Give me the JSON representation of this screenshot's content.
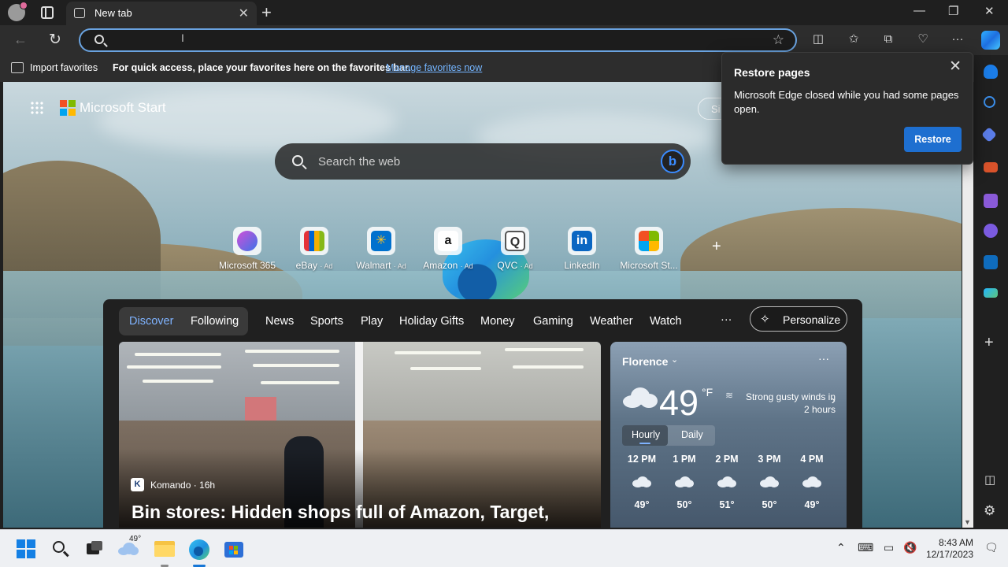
{
  "browser": {
    "tab_title": "New tab",
    "address_value": "",
    "favorites_bar": {
      "import_label": "Import favorites",
      "note": "For quick access, place your favorites here on the favorites bar.",
      "manage_link": "Manage favorites now"
    }
  },
  "page": {
    "brand": "Microsoft Start",
    "signin_label": "Si",
    "search_placeholder": "Search the web",
    "quick_links": [
      {
        "label": "Microsoft 365",
        "ad": ""
      },
      {
        "label": "eBay",
        "ad": "· Ad"
      },
      {
        "label": "Walmart",
        "ad": "· Ad"
      },
      {
        "label": "Amazon",
        "ad": "· Ad"
      },
      {
        "label": "QVC",
        "ad": "· Ad"
      },
      {
        "label": "LinkedIn",
        "ad": ""
      },
      {
        "label": "Microsoft St...",
        "ad": ""
      }
    ],
    "feed": {
      "pivots": [
        "Discover",
        "Following",
        "News",
        "Sports",
        "Play",
        "Holiday Gifts",
        "Money",
        "Gaming",
        "Weather",
        "Watch"
      ],
      "more_label": "···",
      "personalize_label": "Personalize",
      "hero": {
        "source_initial": "K",
        "source": "Komando · 16h",
        "title": "Bin stores: Hidden shops full of Amazon, Target,"
      },
      "weather": {
        "city": "Florence",
        "temp": "49",
        "unit": "°F",
        "alert": "Strong gusty winds in 2 hours",
        "tabs": [
          "Hourly",
          "Daily"
        ],
        "hours": [
          {
            "time": "12 PM",
            "temp": "49°"
          },
          {
            "time": "1 PM",
            "temp": "50°"
          },
          {
            "time": "2 PM",
            "temp": "51°"
          },
          {
            "time": "3 PM",
            "temp": "50°"
          },
          {
            "time": "4 PM",
            "temp": "49°"
          }
        ]
      }
    }
  },
  "restore_popup": {
    "title": "Restore pages",
    "message": "Microsoft Edge closed while you had some pages open.",
    "button": "Restore"
  },
  "taskbar": {
    "weather_temp": "49°",
    "time": "8:43 AM",
    "date": "12/17/2023"
  },
  "colors": {
    "accent": "#1e6fd0",
    "link": "#74b5ff",
    "active_pivot": "#7fb3ff"
  }
}
